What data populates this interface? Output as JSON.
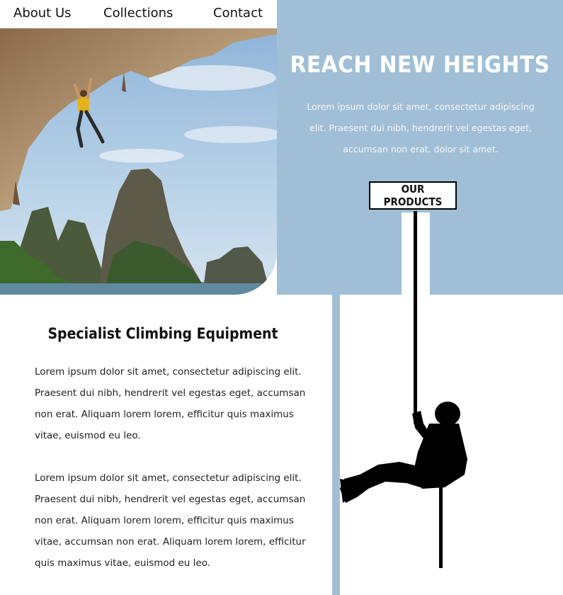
{
  "nav": {
    "items": [
      {
        "label": "About Us"
      },
      {
        "label": "Collections"
      },
      {
        "label": "Contact"
      }
    ]
  },
  "hero": {
    "title": "REACH NEW HEIGHTS",
    "text": "Lorem ipsum dolor sit amet, consectetur adipiscing elit. Praesent dui nibh, hendrerit vel egestas eget, accumsan non erat. dolor sit amet.",
    "cta_label": "OUR PRODUCTS"
  },
  "content": {
    "heading": "Specialist Climbing Equipment",
    "paragraphs": [
      "Lorem ipsum dolor sit amet, consectetur adipiscing elit. Praesent dui nibh, hendrerit vel egestas eget, accumsan non erat. Aliquam lorem lorem, efficitur quis maximus vitae, euismod eu leo.",
      "Lorem ipsum dolor sit amet, consectetur adipiscing elit. Praesent dui nibh, hendrerit vel egestas eget, accumsan non erat. Aliquam lorem lorem, efficitur quis maximus vitae, accumsan non erat. Aliquam lorem lorem, efficitur quis maximus vitae, euismod eu leo."
    ]
  },
  "colors": {
    "accent_blue": "#a0bfd6",
    "text": "#111111",
    "background": "#ffffff"
  },
  "icons": {
    "photo": "rock-climber-photo",
    "silhouette": "rappelling-climber-silhouette"
  }
}
